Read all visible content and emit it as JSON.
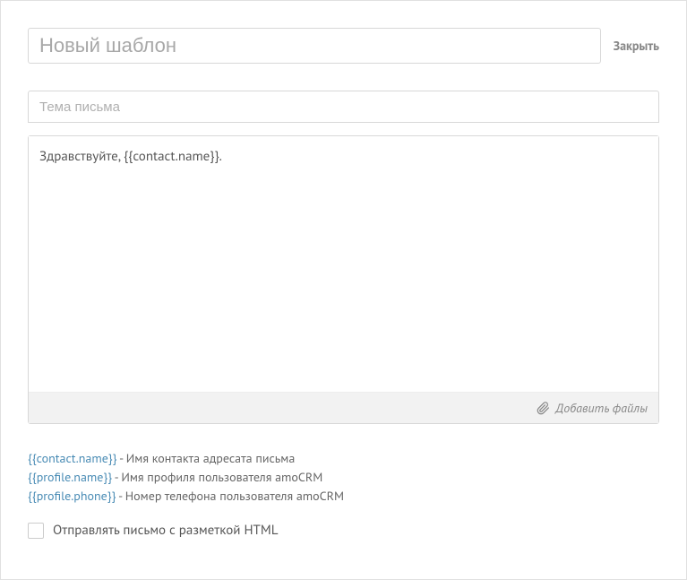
{
  "header": {
    "title_placeholder": "Новый шаблон",
    "close_label": "Закрыть"
  },
  "subject": {
    "placeholder": "Тема письма"
  },
  "body": {
    "value": "Здравствуйте, {{contact.name}}."
  },
  "attach": {
    "label": "Добавить файлы"
  },
  "variables": [
    {
      "tag": "{{contact.name}}",
      "desc": " - Имя контакта адресата письма"
    },
    {
      "tag": "{{profile.name}}",
      "desc": "  - Имя профиля пользователя amoCRM"
    },
    {
      "tag": "{{profile.phone}}",
      "desc": " - Номер телефона пользователя amoCRM"
    }
  ],
  "checkbox": {
    "label": "Отправлять письмо с разметкой HTML"
  }
}
